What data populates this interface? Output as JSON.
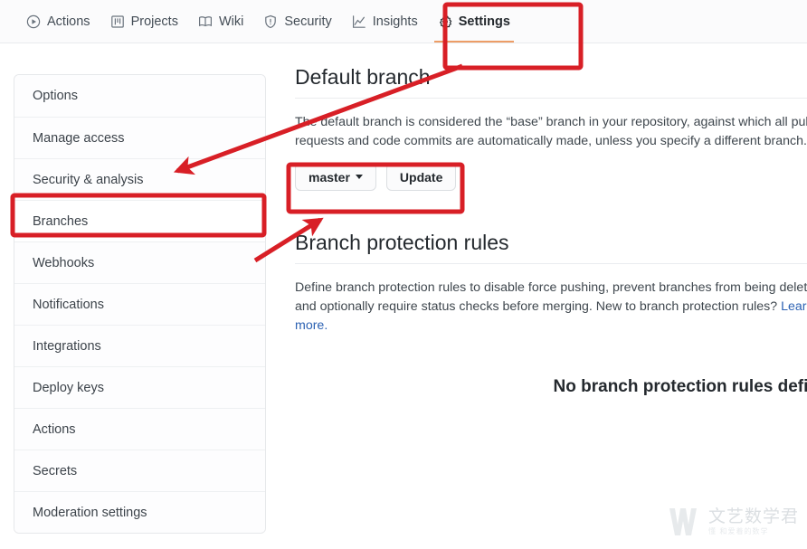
{
  "colors": {
    "annotation_red": "#d81f26",
    "active_tab_underline": "#e36209",
    "link_blue": "#2d62b3",
    "text_primary": "#24292e",
    "border": "#e6e8ea"
  },
  "top_nav": {
    "items": [
      {
        "label": "Actions",
        "icon": "play-circle-icon",
        "active": false
      },
      {
        "label": "Projects",
        "icon": "project-board-icon",
        "active": false
      },
      {
        "label": "Wiki",
        "icon": "book-icon",
        "active": false
      },
      {
        "label": "Security",
        "icon": "shield-icon",
        "active": false
      },
      {
        "label": "Insights",
        "icon": "graph-icon",
        "active": false
      },
      {
        "label": "Settings",
        "icon": "gear-icon",
        "active": true
      }
    ]
  },
  "sidebar": {
    "items": [
      {
        "label": "Options",
        "selected": false
      },
      {
        "label": "Manage access",
        "selected": false
      },
      {
        "label": "Security & analysis",
        "selected": false
      },
      {
        "label": "Branches",
        "selected": true
      },
      {
        "label": "Webhooks",
        "selected": false
      },
      {
        "label": "Notifications",
        "selected": false
      },
      {
        "label": "Integrations",
        "selected": false
      },
      {
        "label": "Deploy keys",
        "selected": false
      },
      {
        "label": "Actions",
        "selected": false
      },
      {
        "label": "Secrets",
        "selected": false
      },
      {
        "label": "Moderation settings",
        "selected": false
      }
    ]
  },
  "main": {
    "default_branch": {
      "title": "Default branch",
      "description": "The default branch is considered the “base” branch in your repository, against which all pull requests and code commits are automatically made, unless you specify a different branch.",
      "branch_button_label": "master",
      "update_button_label": "Update"
    },
    "branch_protection": {
      "title": "Branch protection rules",
      "description_before_link": "Define branch protection rules to disable force pushing, prevent branches from being deleted, and optionally require status checks before merging. New to branch protection rules? ",
      "link_label": "Learn more.",
      "empty_state": "No branch protection rules defined."
    }
  },
  "watermark": {
    "main_text": "文艺数学君",
    "sub_text": "懂 和爱着的数学"
  }
}
